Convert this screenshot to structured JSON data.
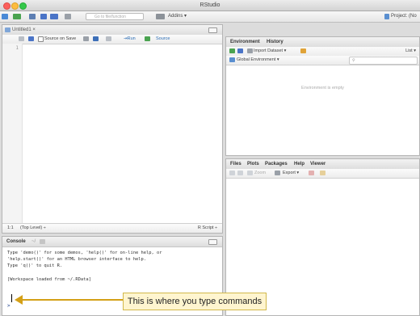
{
  "window": {
    "title": "RStudio"
  },
  "toolbar": {
    "goto_placeholder": "Go to file/function",
    "addins_label": "Addins ▾",
    "project_label": "Project: (No"
  },
  "editor": {
    "tab_label": "Untitled1 ×",
    "source_on_save": "Source on Save",
    "run_label": "⇥Run",
    "source_label": "Source",
    "line_number": "1",
    "status_position": "1:1",
    "status_level": "(Top Level) ÷",
    "status_type": "R Script ÷"
  },
  "console": {
    "title": "Console",
    "path": "~/",
    "lines": [
      "Type 'demo()' for some demos, 'help()' for on-line help, or",
      "'help.start()' for an HTML browser interface to help.",
      "Type 'q()' to quit R.",
      "",
      "[Workspace loaded from ~/.RData]"
    ],
    "prompt": ">"
  },
  "environment": {
    "tabs": [
      "Environment",
      "History"
    ],
    "import_label": "Import Dataset ▾",
    "list_label": "List ▾",
    "scope_label": "Global Environment ▾",
    "empty_message": "Environment is empty"
  },
  "files": {
    "tabs": [
      "Files",
      "Plots",
      "Packages",
      "Help",
      "Viewer"
    ],
    "zoom_label": "Zoom",
    "export_label": "Export ▾"
  },
  "annotation": {
    "text": "This is where you type commands",
    "arrow_color": "#d4a017"
  }
}
